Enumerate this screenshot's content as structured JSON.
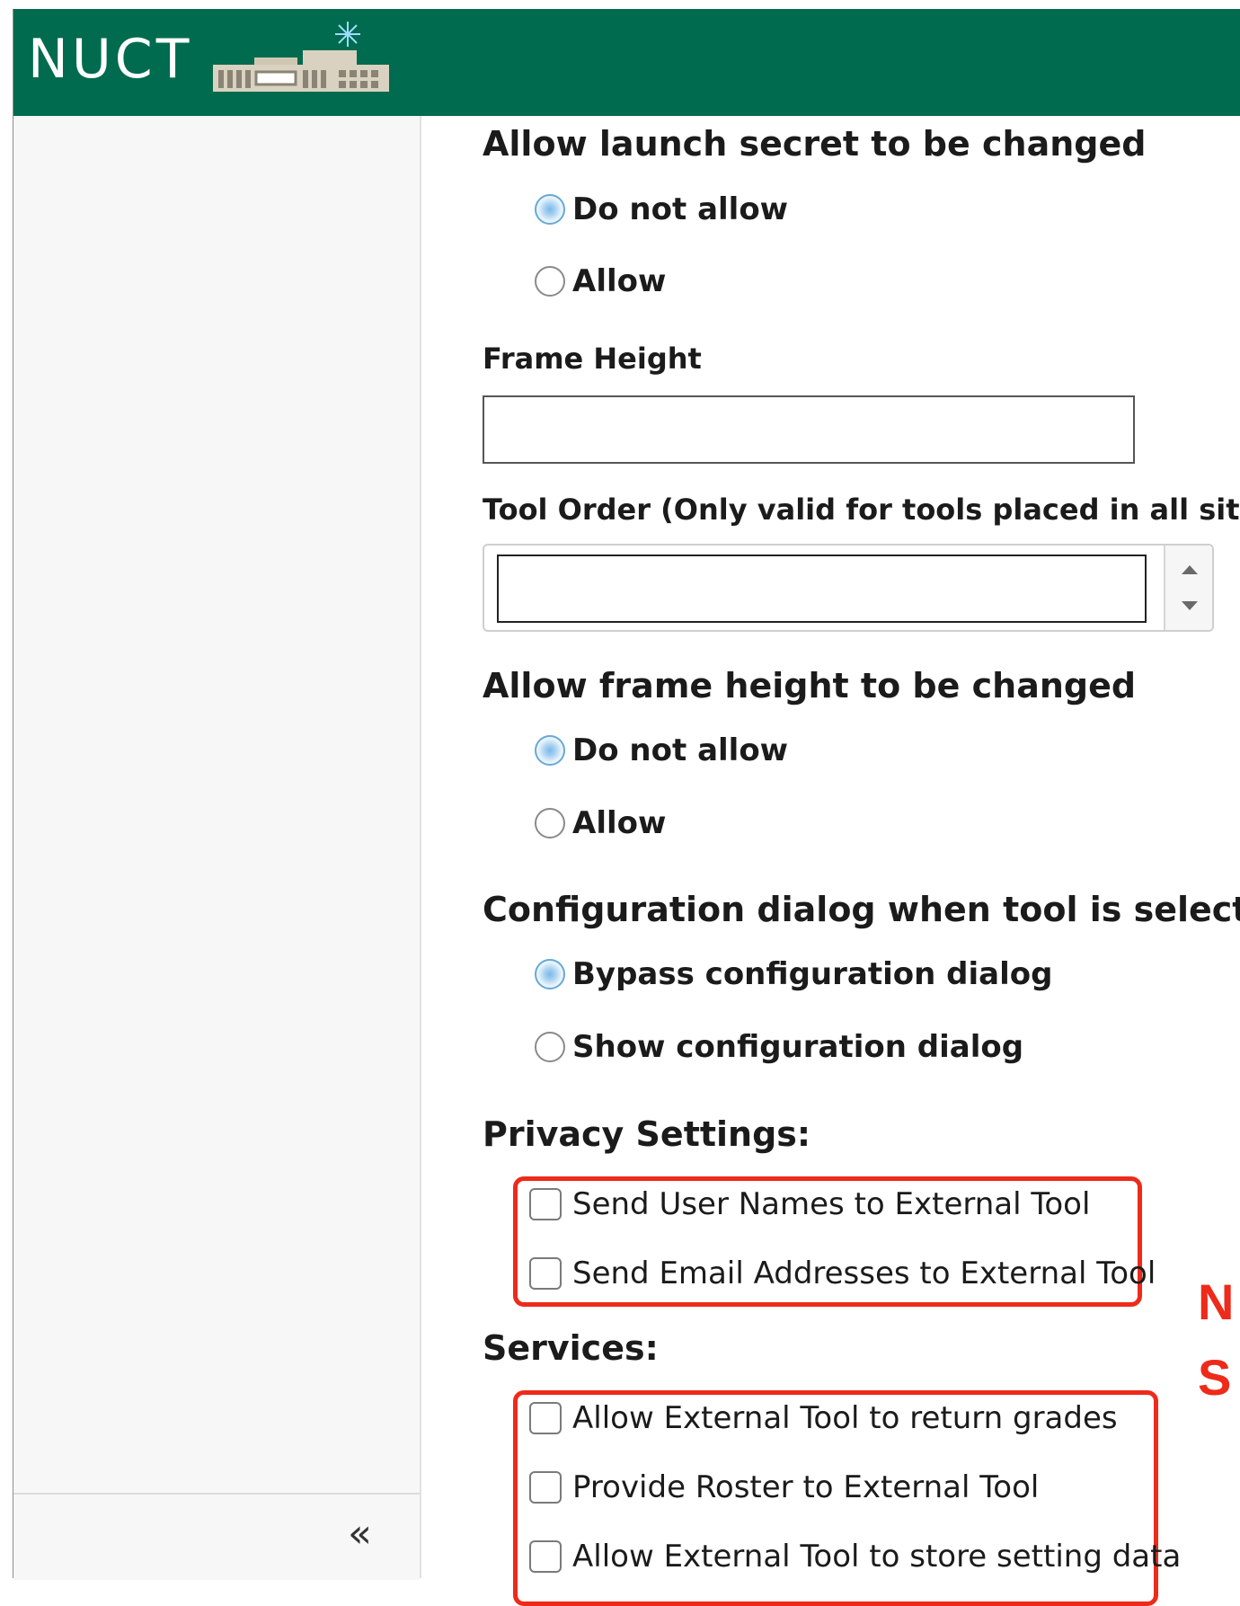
{
  "header": {
    "logo_text": "NUCT",
    "colors": {
      "brand": "#006b4e",
      "accent_red": "#ee2a1a"
    }
  },
  "sidebar": {
    "collapse_icon": "«"
  },
  "form": {
    "launch_secret": {
      "heading": "Allow launch secret to be changed",
      "options": [
        {
          "label": "Do not allow",
          "checked": true
        },
        {
          "label": "Allow",
          "checked": false
        }
      ]
    },
    "frame_height": {
      "label": "Frame Height",
      "value": ""
    },
    "tool_order": {
      "label": "Tool Order (Only valid for tools placed in all sites)",
      "value": ""
    },
    "frame_height_change": {
      "heading": "Allow frame height to be changed",
      "options": [
        {
          "label": "Do not allow",
          "checked": true
        },
        {
          "label": "Allow",
          "checked": false
        }
      ]
    },
    "config_dialog": {
      "heading": "Configuration dialog when tool is selected",
      "options": [
        {
          "label": "Bypass configuration dialog",
          "checked": true
        },
        {
          "label": "Show configuration dialog",
          "checked": false
        }
      ]
    },
    "privacy": {
      "heading": "Privacy Settings:",
      "options": [
        {
          "label": "Send User Names to External Tool",
          "checked": false
        },
        {
          "label": "Send Email Addresses to External Tool",
          "checked": false
        }
      ]
    },
    "services": {
      "heading": "Services:",
      "options": [
        {
          "label": "Allow External Tool to return grades",
          "checked": false
        },
        {
          "label": "Provide Roster to External Tool",
          "checked": false
        },
        {
          "label": "Allow External Tool to store setting data",
          "checked": false
        }
      ]
    }
  },
  "annotation": {
    "line1": "N",
    "line2": "S"
  }
}
